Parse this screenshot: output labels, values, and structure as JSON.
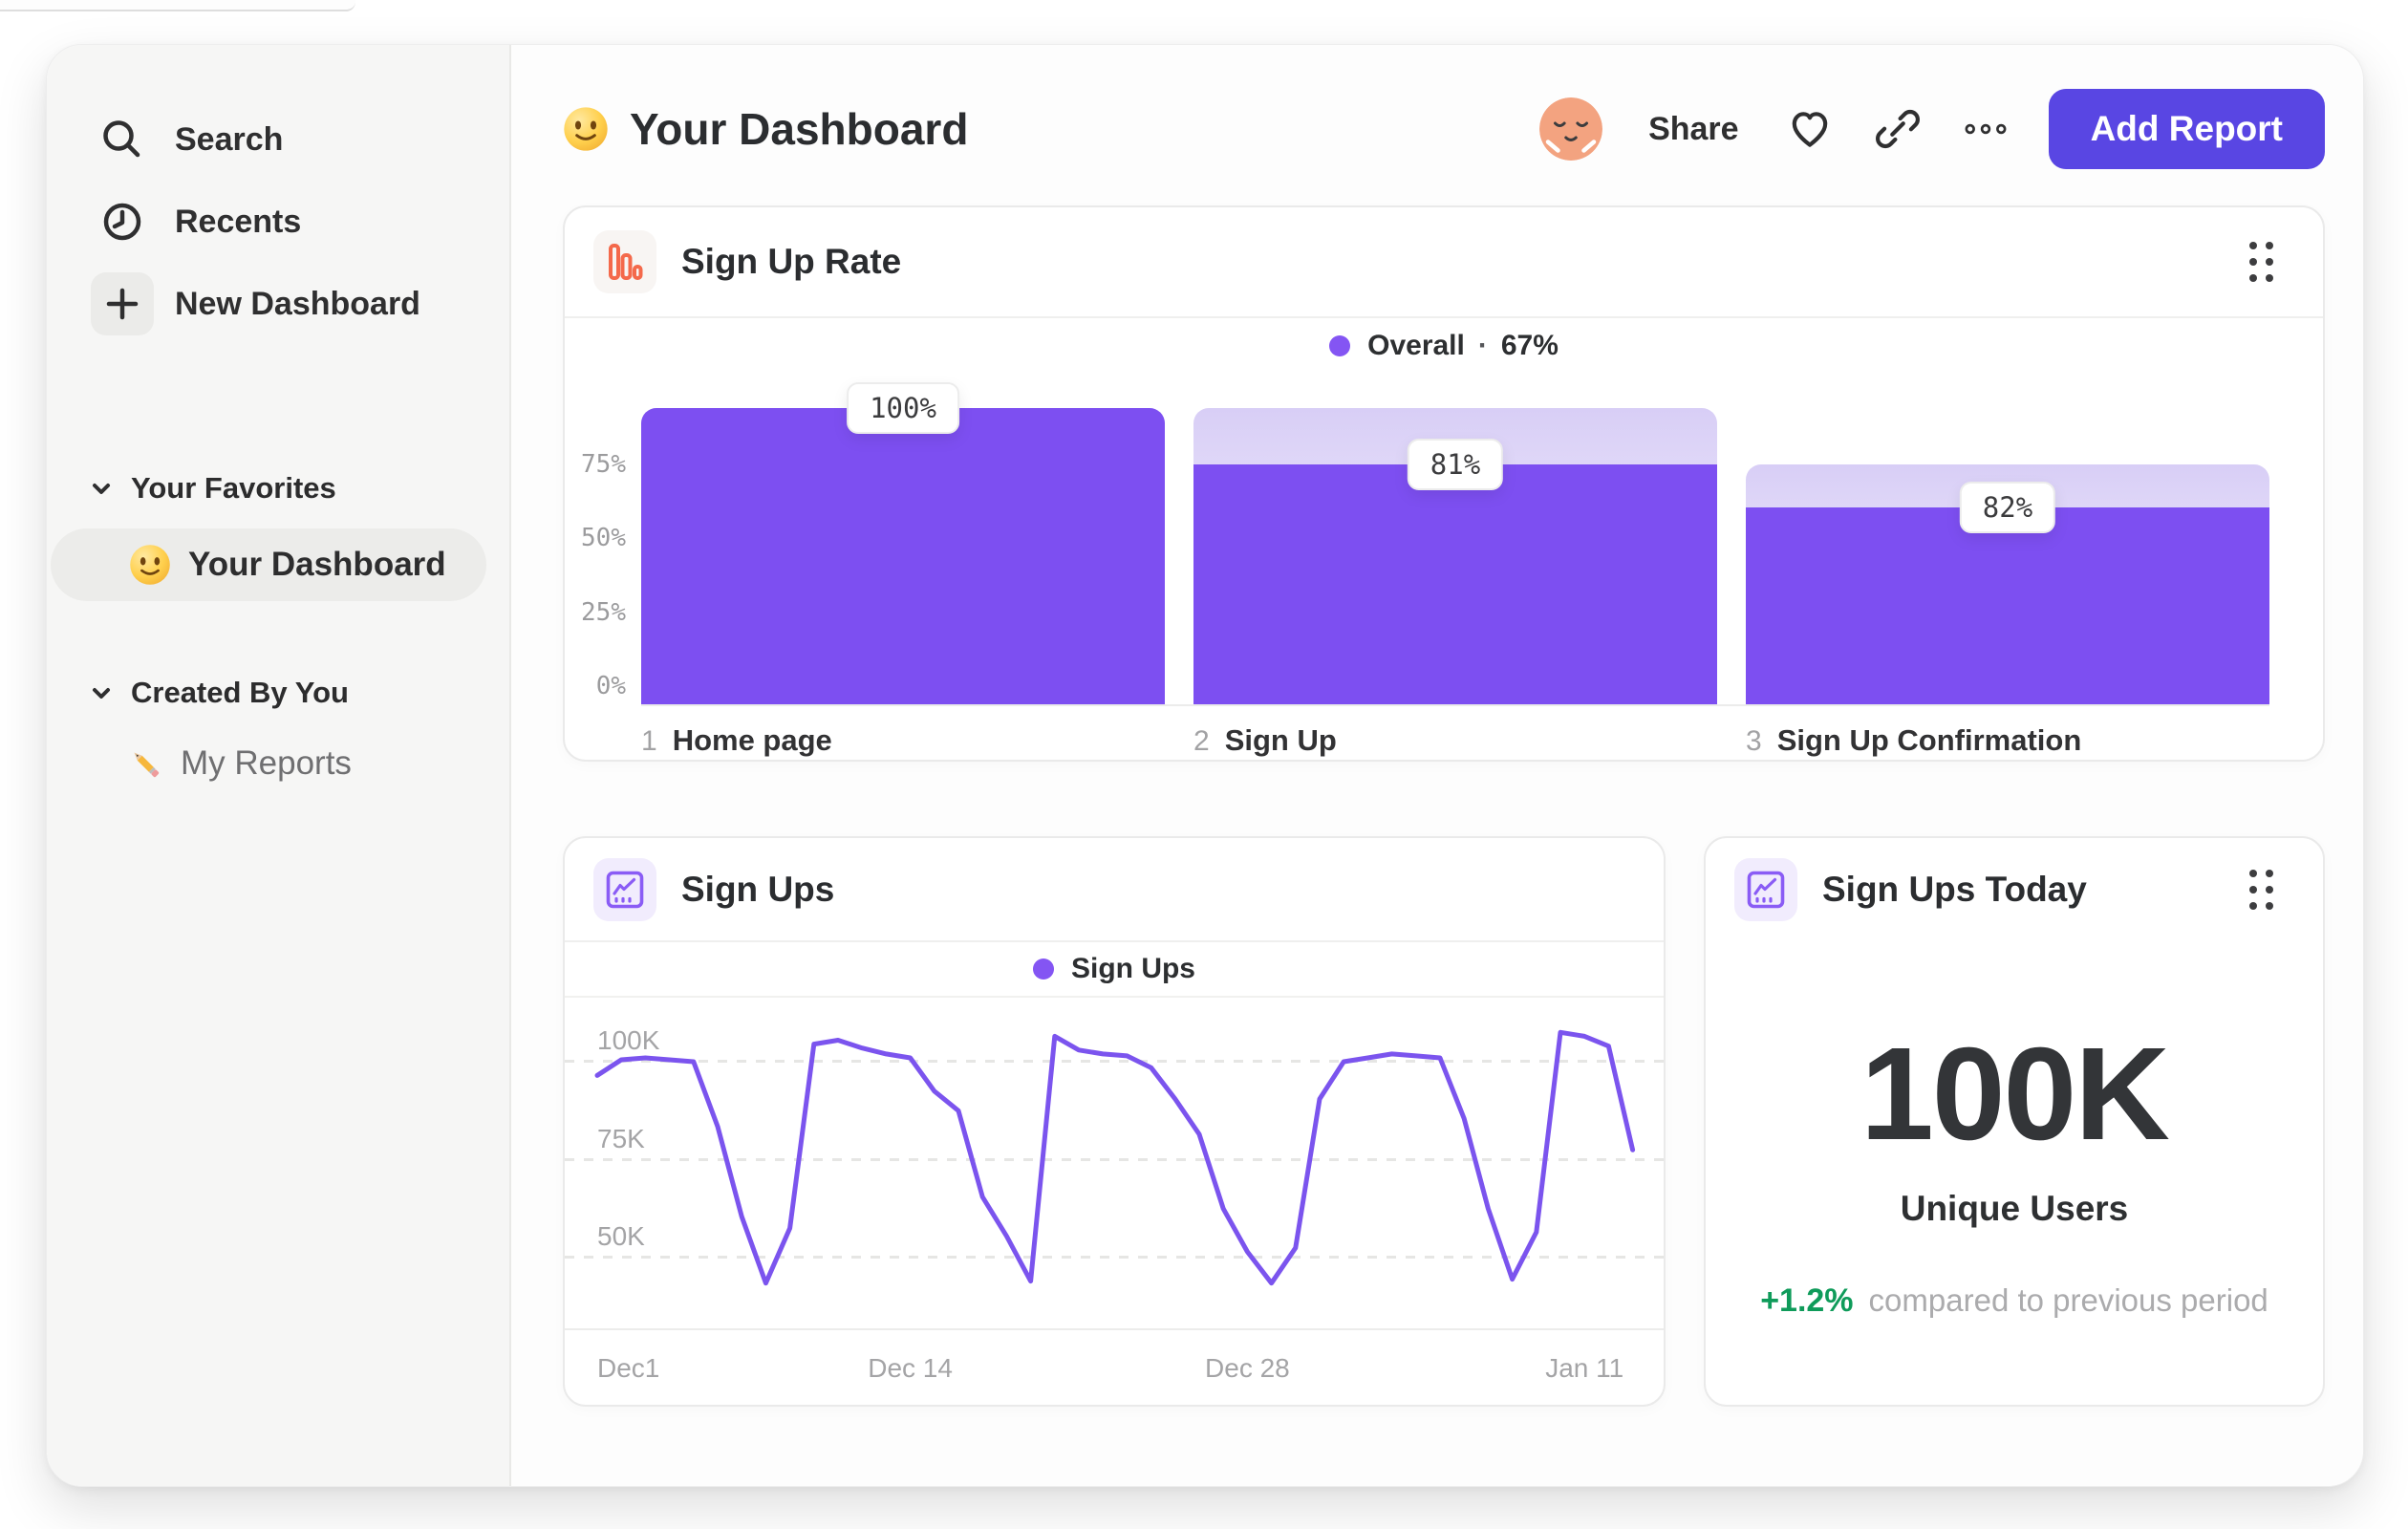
{
  "sidebar": {
    "nav": [
      {
        "label": "Search",
        "icon": "search-icon"
      },
      {
        "label": "Recents",
        "icon": "clock-icon"
      },
      {
        "label": "New Dashboard",
        "icon": "plus-icon"
      }
    ],
    "sections": [
      {
        "title": "Your Favorites",
        "items": [
          {
            "emoji": "smiley",
            "label": "Your Dashboard",
            "selected": true
          }
        ]
      },
      {
        "title": "Created By You",
        "items": [
          {
            "emoji": "pencil",
            "label": "My Reports",
            "selected": false
          }
        ]
      }
    ]
  },
  "header": {
    "emoji": "smiley",
    "title": "Your Dashboard",
    "share_label": "Share",
    "add_report_label": "Add Report",
    "icons": [
      "avatar",
      "heart-icon",
      "link-icon",
      "more-dots-icon"
    ]
  },
  "cards": {
    "signup_rate": {
      "title": "Sign Up Rate",
      "icon": "funnel-chart-icon",
      "legend": {
        "label": "Overall",
        "separator": "·",
        "value": "67%"
      }
    },
    "signups": {
      "title": "Sign Ups",
      "icon": "line-chart-icon",
      "legend": {
        "label": "Sign Ups"
      }
    },
    "signups_today": {
      "title": "Sign Ups Today",
      "icon": "line-chart-icon",
      "value": "100K",
      "label": "Unique Users",
      "delta": "+1.2%",
      "delta_note": "compared to previous period"
    }
  },
  "colors": {
    "accent_purple": "#7d4ff1",
    "line_purple": "#7b54ee",
    "legend_dot_purple": "#8455f3",
    "button_purple": "#5946e3",
    "icon_orange": "#f4694b",
    "delta_green": "#0f9b5a",
    "gray_text": "#a4a4a6",
    "dark_text": "#2b2d30",
    "sidebar_bg": "#f6f6f5"
  },
  "chart_data": [
    {
      "type": "bar",
      "subtype": "funnel",
      "title": "Sign Up Rate",
      "legend": "Overall · 67%",
      "overall_conversion_pct": 67,
      "ylim": [
        0,
        100
      ],
      "yticks": [
        {
          "label": "75%",
          "pct": 75
        },
        {
          "label": "50%",
          "pct": 50
        },
        {
          "label": "25%",
          "pct": 25
        },
        {
          "label": "0%",
          "pct": 0
        }
      ],
      "steps": [
        {
          "num": "1",
          "label": "Home page",
          "value_label": "100%",
          "step_conversion_pct": 100,
          "bar_height_pct": 100,
          "container_height_pct": 100
        },
        {
          "num": "2",
          "label": "Sign Up",
          "value_label": "81%",
          "step_conversion_pct": 81,
          "bar_height_pct": 81,
          "container_height_pct": 100
        },
        {
          "num": "3",
          "label": "Sign Up Confirmation",
          "value_label": "82%",
          "step_conversion_pct": 82,
          "bar_height_pct": 66.4,
          "container_height_pct": 81
        }
      ]
    },
    {
      "type": "line",
      "title": "Sign Ups",
      "legend": "Sign Ups",
      "unit": "K",
      "x_is_daily": true,
      "xticks": [
        {
          "label": "Dec1",
          "day": 0
        },
        {
          "label": "Dec 14",
          "day": 13
        },
        {
          "label": "Dec 28",
          "day": 27
        },
        {
          "label": "Jan 11",
          "day": 41
        }
      ],
      "yticks": [
        {
          "label": "100K",
          "value": 100
        },
        {
          "label": "75K",
          "value": 75
        },
        {
          "label": "50K",
          "value": 50
        }
      ],
      "ylim": [
        31.5,
        115.8
      ],
      "grid": "dashed-horizontal",
      "series": [
        {
          "name": "Sign Ups",
          "values": [
            96,
            100,
            100.5,
            100,
            99.5,
            83,
            60,
            43,
            57,
            104,
            105,
            103,
            101.5,
            100.5,
            92,
            87,
            65,
            55,
            43.5,
            106,
            102.5,
            101.5,
            101,
            98,
            90,
            81,
            62,
            51,
            43,
            52,
            90,
            99.5,
            100.5,
            101.5,
            101,
            100.5,
            85,
            62,
            44,
            56,
            107,
            106,
            103.5,
            77
          ]
        }
      ]
    },
    {
      "type": "metric",
      "title": "Sign Ups Today",
      "value": "100K",
      "label": "Unique Users",
      "delta": "+1.2%",
      "delta_note": "compared to previous period"
    }
  ]
}
